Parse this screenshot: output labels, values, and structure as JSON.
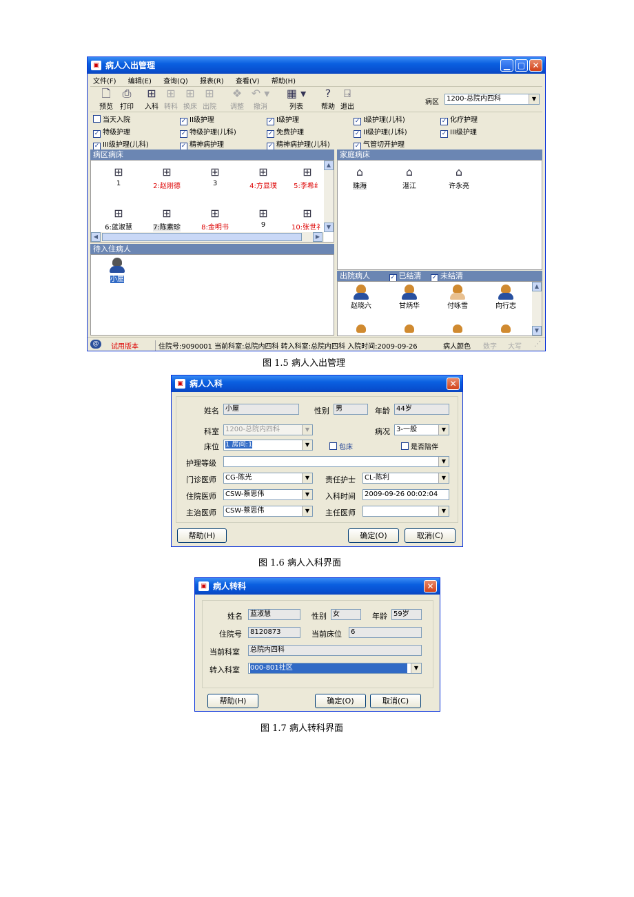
{
  "main_window": {
    "title": "病人入出管理",
    "menu": [
      "文件(F)",
      "编辑(E)",
      "查询(Q)",
      "报表(R)",
      "查看(V)",
      "帮助(H)"
    ],
    "toolbar": {
      "preview": "预览",
      "print": "打印",
      "admit": "入科",
      "transfer": "转科",
      "change_bed": "换床",
      "discharge": "出院",
      "adjust": "调整",
      "undo": "撤消",
      "list": "列表",
      "help": "帮助",
      "exit": "退出"
    },
    "ward_label": "病区",
    "ward_value": "1200-总院内四科",
    "filters": [
      {
        "label": "当天入院",
        "checked": false
      },
      {
        "label": "II级护理",
        "checked": true
      },
      {
        "label": "I级护理",
        "checked": true
      },
      {
        "label": "I级护理(儿科)",
        "checked": true
      },
      {
        "label": "化疗护理",
        "checked": true
      },
      {
        "label": "特级护理",
        "checked": true
      },
      {
        "label": "特级护理(儿科)",
        "checked": true
      },
      {
        "label": "免费护理",
        "checked": true
      },
      {
        "label": "II级护理(儿科)",
        "checked": true
      },
      {
        "label": "III级护理",
        "checked": true
      },
      {
        "label": "III级护理(儿科)",
        "checked": true
      },
      {
        "label": "精神病护理",
        "checked": true
      },
      {
        "label": "精神病护理(儿科)",
        "checked": true
      },
      {
        "label": "气管切开护理",
        "checked": true
      }
    ],
    "ward_beds_header": "病区病床",
    "beds": [
      {
        "label": "1",
        "occupied": false
      },
      {
        "label": "2:赵刚德",
        "occupied": true
      },
      {
        "label": "3",
        "occupied": false
      },
      {
        "label": "4:方显璞",
        "occupied": true
      },
      {
        "label": "5:李希纟",
        "occupied": true
      },
      {
        "label": "6:蓝淑慧",
        "occupied": true
      },
      {
        "label": "7:陈素珍",
        "occupied": true
      },
      {
        "label": "8:金明书",
        "occupied": true
      },
      {
        "label": "9",
        "occupied": false
      },
      {
        "label": "10:张世礻",
        "occupied": true
      }
    ],
    "home_beds_header": "家庭病床",
    "home_beds": [
      "珠海",
      "湛江",
      "许永亮"
    ],
    "waiting_header": "待入住病人",
    "waiting": [
      "小屋"
    ],
    "discharged_header": "出院病人",
    "settled_label": "已结清",
    "unsettled_label": "未结清",
    "discharged": [
      "赵晓六",
      "甘炳华",
      "付咏雪",
      "向行志"
    ],
    "status": {
      "version": "试用版本",
      "info": "住院号:9090001  当前科室:总院内四科  转入科室:总院内四科  入院时间:2009-09-26",
      "color": "病人颜色",
      "num": "数字",
      "caps": "大写"
    }
  },
  "caption_1": "图 1.5   病人入出管理",
  "admit_dialog": {
    "title": "病人入科",
    "name_label": "姓名",
    "name": "小屋",
    "sex_label": "性别",
    "sex": "男",
    "age_label": "年龄",
    "age": "44岁",
    "dept_label": "科室",
    "dept": "1200-总院内四科",
    "condition_label": "病况",
    "condition": "3-一般",
    "bed_label": "床位",
    "bed": "1 房间:1",
    "package_bed": "包床",
    "escort": "是否陪伴",
    "nursing_label": "护理等级",
    "nursing": "",
    "clinic_doc_label": "门诊医师",
    "clinic_doc": "CG-陈光",
    "nurse_label": "责任护士",
    "nurse": "CL-陈利",
    "ward_doc_label": "住院医师",
    "ward_doc": "CSW-蔡思伟",
    "admit_time_label": "入科时间",
    "admit_time": "2009-09-26 00:02:04",
    "attending_label": "主治医师",
    "attending": "CSW-蔡思伟",
    "director_label": "主任医师",
    "director": "",
    "help": "帮助(H)",
    "ok": "确定(O)",
    "cancel": "取消(C)"
  },
  "caption_2": "图 1.6    病人入科界面",
  "transfer_dialog": {
    "title": "病人转科",
    "name_label": "姓名",
    "name": "蓝淑慧",
    "sex_label": "性别",
    "sex": "女",
    "age_label": "年龄",
    "age": "59岁",
    "inpatient_label": "住院号",
    "inpatient": "8120873",
    "bed_label": "当前床位",
    "bed": "6",
    "cur_dept_label": "当前科室",
    "cur_dept": "总院内四科",
    "to_dept_label": "转入科室",
    "to_dept": "000-801社区",
    "help": "帮助(H)",
    "ok": "确定(O)",
    "cancel": "取消(C)"
  },
  "caption_3": "图  1.7   病人转科界面"
}
